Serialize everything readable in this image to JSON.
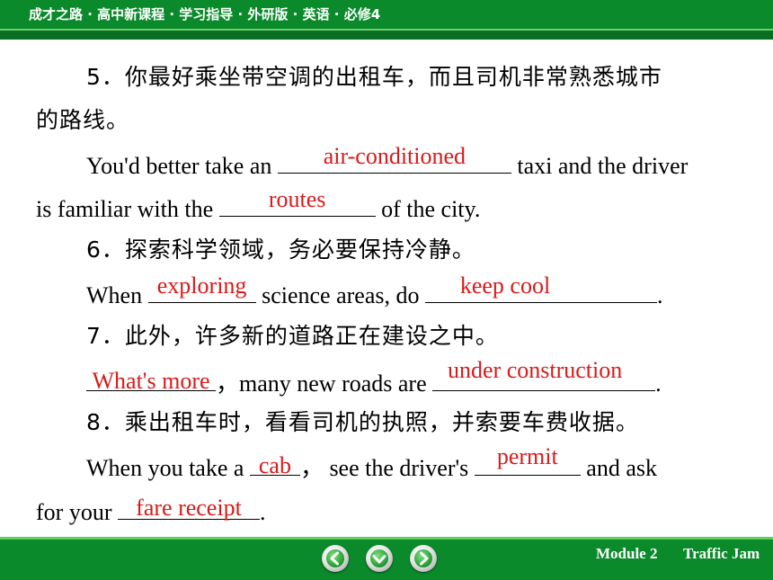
{
  "header": {
    "title": "成才之路 · 高中新课程 · 学习指导 · 外研版 · 英语 · 必修4"
  },
  "items": [
    {
      "cn": "5．你最好乘坐带空调的出租车，而且司机非常熟悉城市",
      "cn_cont": "的路线。",
      "en1_a": "You'd better take an ",
      "ans1": "air-conditioned",
      "en1_b": " taxi and the driver",
      "en2_a": "is familiar with the ",
      "ans2": "routes",
      "en2_b": " of the city."
    },
    {
      "cn": "6．探索科学领域，务必要保持冷静。",
      "en_a": "When ",
      "ans1": "exploring",
      "en_b": " science areas, do ",
      "ans2": "keep cool",
      "en_c": "."
    },
    {
      "cn": "7．此外，许多新的道路正在建设之中。",
      "ans1": "What's more",
      "en_a": "，many new roads are ",
      "ans2": "under construction",
      "en_b": "."
    },
    {
      "cn": "8．乘出租车时，看看司机的执照，并索要车费收据。",
      "en_a": "When you take a ",
      "ans1": "cab",
      "en_b": "，  see the driver's ",
      "ans2": "permit",
      "en_c": "  and ask",
      "en2_a": "for your ",
      "ans3": "fare receipt",
      "en2_b": "."
    }
  ],
  "footer": {
    "module": "Module 2",
    "unit": "Traffic Jam"
  },
  "nav": {
    "prev_icon": "arrow-left-icon",
    "down_icon": "arrow-down-icon",
    "next_icon": "arrow-right-icon"
  },
  "colors": {
    "bar": "#0a8a2a",
    "answer": "#d91a1a"
  }
}
